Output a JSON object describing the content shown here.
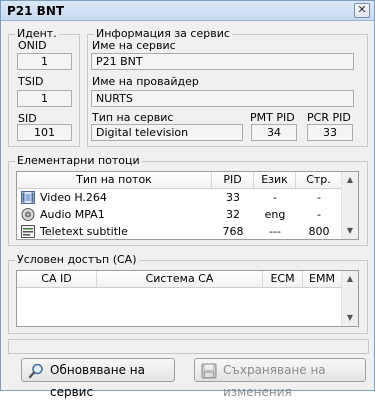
{
  "window": {
    "title": "P21 BNT",
    "close_label": "✕"
  },
  "ident": {
    "legend": "Идент.",
    "onid_label": "ONID",
    "onid_value": "1",
    "tsid_label": "TSID",
    "tsid_value": "1",
    "sid_label": "SID",
    "sid_value": "101"
  },
  "service_info": {
    "legend": "Информация за сервис",
    "name_label": "Име на сервис",
    "name_value": "P21 BNT",
    "provider_label": "Име на провайдер",
    "provider_value": "NURTS",
    "type_label": "Тип на сервис",
    "type_value": "Digital television",
    "pmt_label": "PMT PID",
    "pmt_value": "34",
    "pcr_label": "PCR PID",
    "pcr_value": "33"
  },
  "streams": {
    "legend": "Елементарни потоци",
    "columns": [
      "Тип на поток",
      "PID",
      "Език",
      "Стр."
    ],
    "rows": [
      {
        "icon": "video-icon",
        "type": "Video H.264",
        "pid": "33",
        "lang": "-",
        "pages": "-"
      },
      {
        "icon": "audio-icon",
        "type": "Audio MPA1",
        "pid": "32",
        "lang": "eng",
        "pages": "-"
      },
      {
        "icon": "teletext-icon",
        "type": "Teletext subtitle",
        "pid": "768",
        "lang": "---",
        "pages": "800"
      }
    ]
  },
  "conditional_access": {
    "legend": "Условен достъп (CA)",
    "columns": [
      "CA ID",
      "Система CA",
      "ECM",
      "EMM"
    ]
  },
  "buttons": {
    "refresh_label": "Обновяване на сервис",
    "refresh_icon": "magnifier-icon",
    "save_label": "Съхраняване на изменения",
    "save_icon": "floppy-disk-icon"
  },
  "colors": {
    "title_gradient_top": "#dbe8f7",
    "window_bg": "#f0f0f0",
    "disabled_text": "#8c8c8c"
  }
}
